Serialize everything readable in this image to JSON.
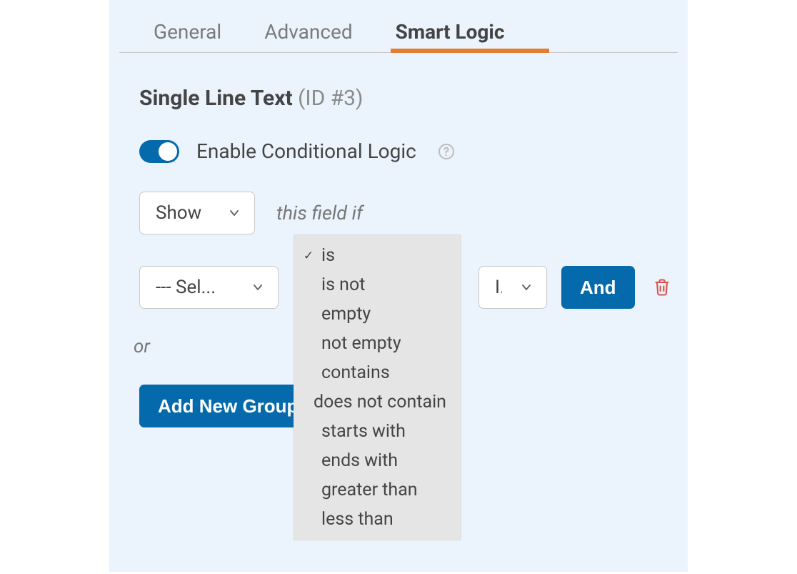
{
  "tabs": {
    "general": "General",
    "advanced": "Advanced",
    "smart_logic": "Smart Logic",
    "active": "smart_logic"
  },
  "field": {
    "name": "Single Line Text",
    "id_label": "(ID #3)"
  },
  "toggle": {
    "enabled": true,
    "label": "Enable Conditional Logic"
  },
  "action_select": {
    "value": "Show"
  },
  "hint": "this field if",
  "rule": {
    "field_value": "--- Sel...",
    "value_value": "I...",
    "and_label": "And"
  },
  "operator_dropdown": {
    "selected_index": 0,
    "options": [
      "is",
      "is not",
      "empty",
      "not empty",
      "contains",
      "does not contain",
      "starts with",
      "ends with",
      "greater than",
      "less than"
    ]
  },
  "or_label": "or",
  "add_group_label": "Add New Group"
}
